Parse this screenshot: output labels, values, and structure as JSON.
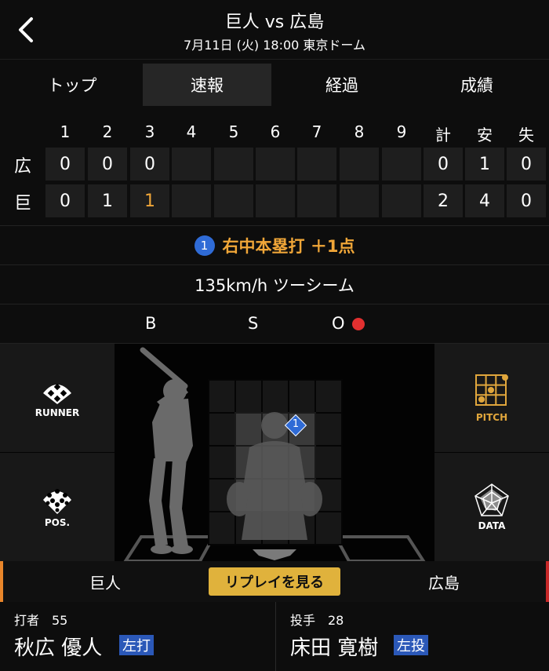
{
  "header": {
    "title": "巨人 vs 広島",
    "subtitle": "7月11日 (火) 18:00 東京ドーム"
  },
  "tabs": [
    {
      "label": "トップ"
    },
    {
      "label": "速報",
      "active": true
    },
    {
      "label": "経過"
    },
    {
      "label": "成績"
    }
  ],
  "scoreboard": {
    "innings": [
      "1",
      "2",
      "3",
      "4",
      "5",
      "6",
      "7",
      "8",
      "9"
    ],
    "totals_headers": [
      "計",
      "安",
      "失"
    ],
    "teams": [
      {
        "label": "広",
        "scores": [
          "0",
          "0",
          "0",
          "",
          "",
          "",
          "",
          "",
          ""
        ],
        "totals": [
          "0",
          "1",
          "0"
        ]
      },
      {
        "label": "巨",
        "scores": [
          "0",
          "1",
          "1",
          "",
          "",
          "",
          "",
          "",
          ""
        ],
        "totals": [
          "2",
          "4",
          "0"
        ],
        "highlight_index": 2
      }
    ]
  },
  "play": {
    "number": "1",
    "text": "右中本塁打 ＋1点"
  },
  "pitch": {
    "text": "135km/h ツーシーム"
  },
  "count": {
    "b": "B",
    "s": "S",
    "o": "O",
    "outs": 1
  },
  "field": {
    "runner_label": "RUNNER",
    "pos_label": "POS.",
    "pitch_label": "PITCH",
    "data_label": "DATA",
    "pitch_marker": "1"
  },
  "team_bar": {
    "home": "巨人",
    "replay": "リプレイを見る",
    "away": "広島"
  },
  "batter": {
    "role": "打者　55",
    "name": "秋広 優人",
    "badge": "左打"
  },
  "pitcher": {
    "role": "投手　28",
    "name": "床田 寛樹",
    "badge": "左投"
  },
  "colors": {
    "accent": "#f0a638",
    "badge_blue": "#2b58b8",
    "replay_gold": "#e0b23c",
    "out_red": "#e23030"
  }
}
